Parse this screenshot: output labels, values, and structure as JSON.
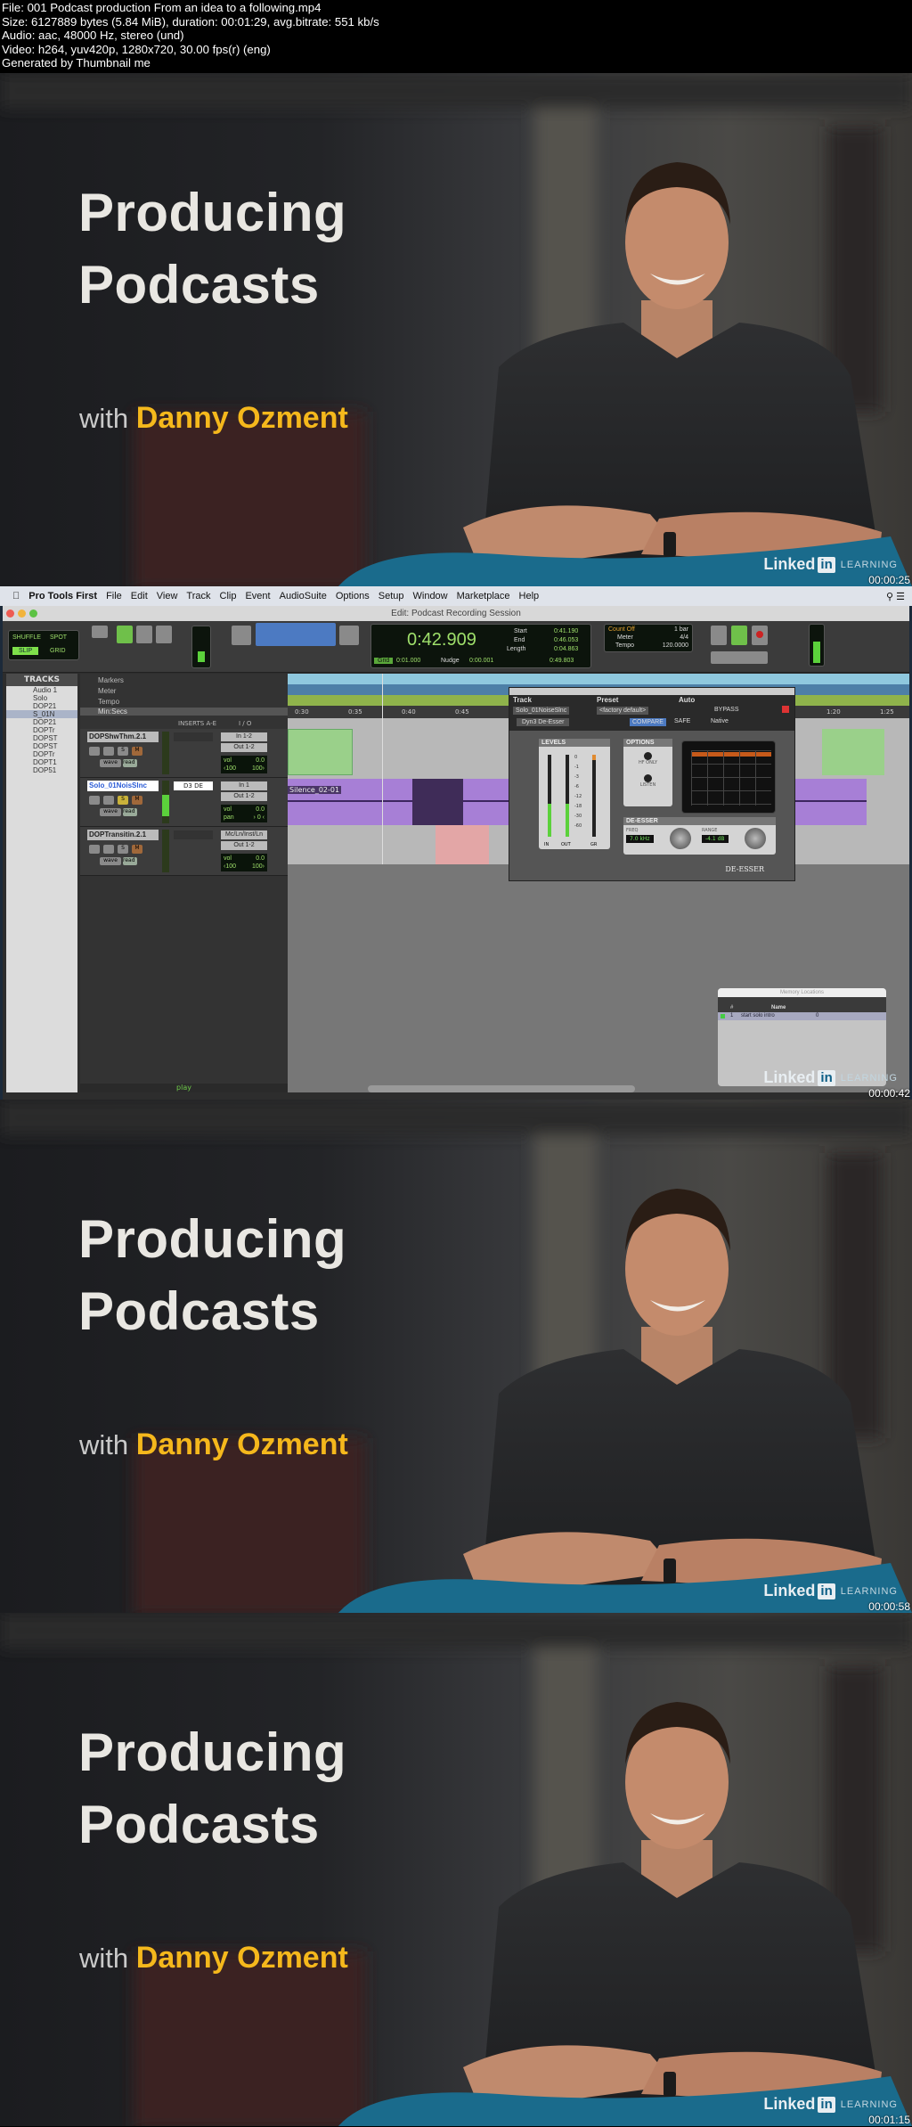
{
  "info": {
    "lines": [
      "File: 001 Podcast production   From an idea to a following.mp4",
      "Size: 6127889 bytes (5.84 MiB), duration: 00:01:29, avg.bitrate: 551 kb/s",
      "Audio: aac, 48000 Hz, stereo (und)",
      "Video: h264, yuv420p, 1280x720, 30.00 fps(r) (eng)",
      "Generated by Thumbnail me"
    ]
  },
  "title_card": {
    "line1": "Producing",
    "line2": "Podcasts",
    "with": "with",
    "author": "Danny Ozment"
  },
  "branding": {
    "linked": "Linked",
    "in": "in",
    "learning": "LEARNING"
  },
  "colors": {
    "author": "#f5b81c",
    "chair": "#1a6b8c",
    "pt_lcd_text": "#9fe06b",
    "clip_green": "#9ad08a",
    "clip_purple": "#a77fd6"
  },
  "frames": [
    {
      "type": "title",
      "timestamp": "00:00:25"
    },
    {
      "type": "protools",
      "timestamp": "00:00:42"
    },
    {
      "type": "title",
      "timestamp": "00:00:58"
    },
    {
      "type": "title",
      "timestamp": "00:01:15"
    }
  ],
  "protools": {
    "menu": [
      "Pro Tools First",
      "File",
      "Edit",
      "View",
      "Track",
      "Clip",
      "Event",
      "AudioSuite",
      "Options",
      "Setup",
      "Window",
      "Marketplace",
      "Help"
    ],
    "window_title": "Edit: Podcast Recording Session",
    "edit_modes": [
      "SHUFFLE",
      "SPOT",
      "SLIP",
      "GRID"
    ],
    "counter": "0:42.909",
    "start_label": "Start",
    "start": "0:41.190",
    "end_label": "End",
    "end": "0:46.053",
    "length_label": "Length",
    "length": "0:04.863",
    "grid_label": "Grid",
    "grid": "0:01.000",
    "nudge_label": "Nudge",
    "nudge": "0:00.001",
    "cursor": "0:49.803",
    "count_off": "Count Off",
    "count_off_val": "1 bar",
    "meter_label": "Meter",
    "meter": "4/4",
    "tempo_label": "Tempo",
    "tempo": "120.0000",
    "tracks_header": "TRACKS",
    "track_list": [
      "Audio 1",
      "Solo",
      "DOP21",
      "S_01N",
      "DOP21",
      "DOPTr",
      "DOPST",
      "DOPST",
      "DOPTr",
      "DOPT1",
      "DOP51"
    ],
    "rulers": [
      "Markers",
      "Meter",
      "Tempo",
      "Min:Secs"
    ],
    "ruler_ticks": [
      "0:30",
      "0:35",
      "0:40",
      "0:45",
      "1:20",
      "1:25"
    ],
    "inserts_header": "INSERTS A-E",
    "io_header": "I / O",
    "tracks": [
      {
        "name": "DOPShwThm.2.1",
        "insert": "",
        "in": "In 1-2",
        "out": "Out 1-2",
        "vol": "vol",
        "vol_val": "0.0",
        "pan_l": "‹100",
        "pan_r": "100›"
      },
      {
        "name": "Solo_01NoisSlnc",
        "insert": "D3 DE",
        "in": "In 1",
        "out": "Out 1-2",
        "vol": "vol",
        "vol_val": "0.0",
        "pan_l": "pan",
        "pan_r": "› 0 ‹"
      },
      {
        "name": "DOPTransitin.2.1",
        "insert": "",
        "in": "Mc/Ln/Inst/Ln",
        "out": "Out 1-2",
        "vol": "vol",
        "vol_val": "0.0",
        "pan_l": "‹100",
        "pan_r": "100›"
      }
    ],
    "track_buttons": [
      "S",
      "M",
      "wave",
      "read"
    ],
    "clip_name": "Silence_02-01",
    "status": "play",
    "plugin": {
      "track_label": "Track",
      "preset_label": "Preset",
      "auto_label": "Auto",
      "track": "Solo_01NoiseSlnc",
      "track_suffix": "a",
      "preset": "<factory default>",
      "plugin_name": "Dyn3 De-Esser",
      "bypass": "BYPASS",
      "compare": "COMPARE",
      "safe": "SAFE",
      "native": "Native",
      "levels": "LEVELS",
      "options": "OPTIONS",
      "hf_only": "HF ONLY",
      "listen": "LISTEN",
      "meter_in": "IN",
      "meter_out": "OUT",
      "meter_gr": "GR",
      "scale": [
        "0",
        "-1",
        "-3",
        "-6",
        "-12",
        "-18",
        "-30",
        "-60"
      ],
      "section": "DE-ESSER",
      "freq_label": "FREQ",
      "freq": "7.0 kHz",
      "range_label": "RANGE",
      "range": "-4.1 dB",
      "logo": "DE-ESSER",
      "in_level": 0.4,
      "out_level": 0.4
    },
    "memory": {
      "title": "Memory Locations",
      "col_num": "#",
      "col_name": "Name",
      "rows": [
        {
          "num": "1",
          "name": "start solo intro",
          "marker": "0"
        }
      ]
    }
  }
}
